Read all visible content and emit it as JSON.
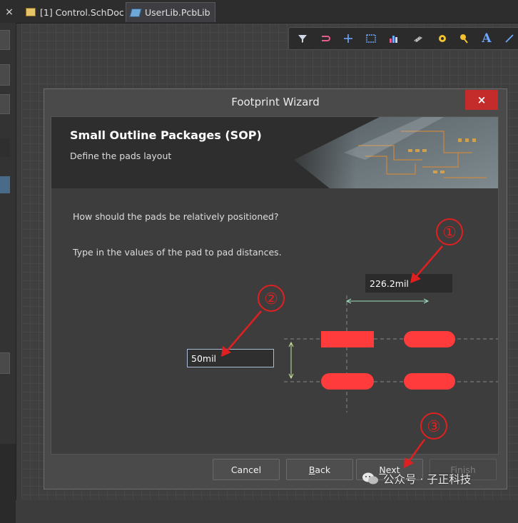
{
  "tabs": [
    {
      "label": "[1] Control.SchDoc",
      "icon": "schdoc-icon"
    },
    {
      "label": "UserLib.PcbLib",
      "icon": "pcblib-icon",
      "active": true
    }
  ],
  "tab_close_glyph": "×",
  "toolbar": {
    "icons": [
      "filter-icon",
      "route-icon",
      "crosshair-icon",
      "select-rect-icon",
      "chart-icon",
      "component-icon",
      "pad-icon",
      "via-icon",
      "text-icon",
      "line-icon"
    ],
    "text_glyph": "A"
  },
  "dialog": {
    "title": "Footprint Wizard",
    "close_glyph": "×",
    "header": {
      "title": "Small Outline Packages (SOP)",
      "subtitle": "Define the pads layout"
    },
    "question_position": "How should the pads be relatively positioned?",
    "question_distances": "Type in the values of the pad to pad distances.",
    "pitch_value": "226.2mil",
    "spacing_value": "50mil",
    "buttons": {
      "cancel": "Cancel",
      "back_prefix": "",
      "back_access_key": "B",
      "back_rest": "ack",
      "next_prefix": "",
      "next_access_key": "N",
      "next_rest": "ext",
      "finish": "Finish"
    }
  },
  "annotations": [
    "①",
    "②",
    "③"
  ],
  "watermark": "公众号 · 子正科技",
  "colors": {
    "pad_red": "#ff3b3b",
    "annotation_red": "#e02020",
    "dim_line": "#9fe0c0",
    "close_red": "#c42b2b"
  }
}
